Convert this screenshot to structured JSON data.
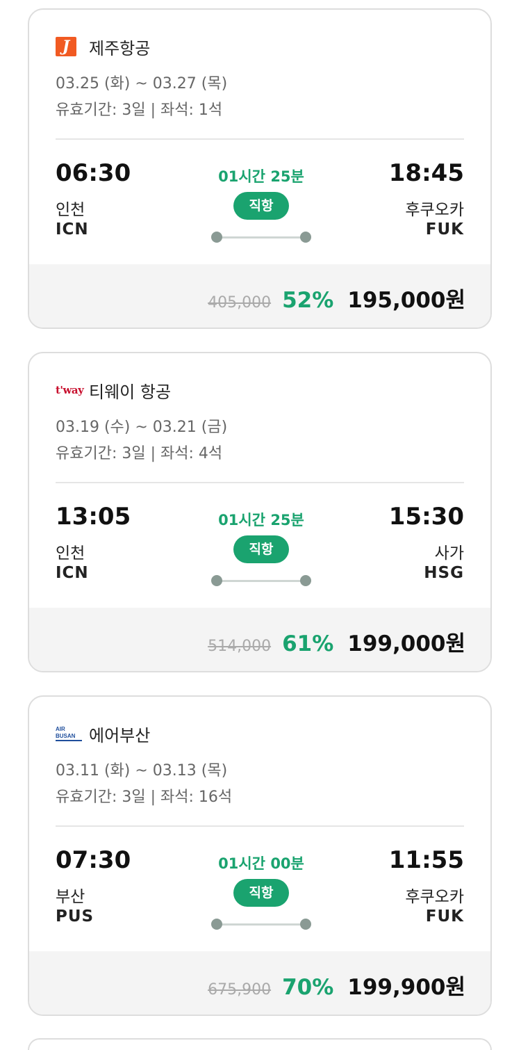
{
  "flights": [
    {
      "airline": "제주항공",
      "logo_icon": "jejuair-logo-icon",
      "logo_text": "J",
      "dates": "03.25 (화) ~ 03.27 (목)",
      "validity": "유효기간: 3일 | 좌석: 1석",
      "dep_time": "06:30",
      "dep_city": "인천",
      "dep_code": "ICN",
      "arr_time": "18:45",
      "arr_city": "후쿠오카",
      "arr_code": "FUK",
      "duration": "01시간 25분",
      "direct": "직항",
      "original_price": "405,000",
      "discount": "52%",
      "price": "195,000원"
    },
    {
      "airline": "티웨이 항공",
      "logo_icon": "tway-logo-icon",
      "logo_text": "t'way",
      "dates": "03.19 (수) ~ 03.21 (금)",
      "validity": "유효기간: 3일 | 좌석: 4석",
      "dep_time": "13:05",
      "dep_city": "인천",
      "dep_code": "ICN",
      "arr_time": "15:30",
      "arr_city": "사가",
      "arr_code": "HSG",
      "duration": "01시간 25분",
      "direct": "직항",
      "original_price": "514,000",
      "discount": "61%",
      "price": "199,000원"
    },
    {
      "airline": "에어부산",
      "logo_icon": "airbusan-logo-icon",
      "logo_text": "AIR BUSAN",
      "dates": "03.11 (화) ~ 03.13 (목)",
      "validity": "유효기간: 3일 | 좌석: 16석",
      "dep_time": "07:30",
      "dep_city": "부산",
      "dep_code": "PUS",
      "arr_time": "11:55",
      "arr_city": "후쿠오카",
      "arr_code": "FUK",
      "duration": "01시간 00분",
      "direct": "직항",
      "original_price": "675,900",
      "discount": "70%",
      "price": "199,900원"
    }
  ],
  "colors": {
    "accent": "#1aa36f",
    "jeju_brand": "#f15a22",
    "tway_brand": "#c8102e",
    "airbusan_brand": "#1f4e9c"
  }
}
